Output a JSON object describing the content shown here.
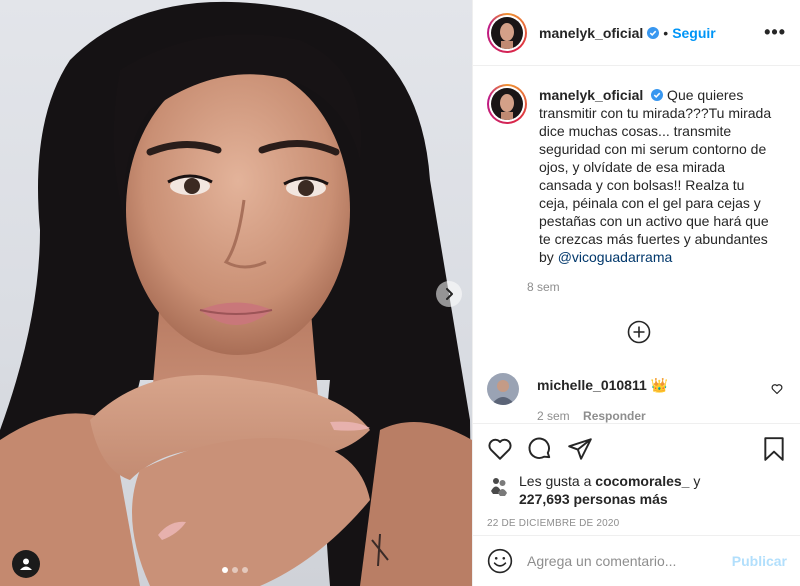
{
  "header": {
    "username": "manelyk_oficial",
    "separator": "•",
    "follow_label": "Seguir",
    "more_label": "•••"
  },
  "caption": {
    "username": "manelyk_oficial",
    "text": " Que quieres transmitir con tu mirada???Tu mirada dice muchas cosas... transmite seguridad con mi serum contorno de ojos, y olvídate de esa mirada cansada y con bolsas!! Realza tu ceja, péinala con el gel para cejas y pestañas con un activo que hará que te crezcas más fuertes y abundantes by ",
    "mention": "@vicoguadarrama",
    "time": "8 sem"
  },
  "comments": [
    {
      "username": "michelle_010811",
      "emoji": "👑",
      "time": "2 sem",
      "reply_label": "Responder"
    }
  ],
  "likes": {
    "prefix": "Les gusta a ",
    "user": "cocomorales_",
    "middle": " y",
    "count": "227,693 personas más"
  },
  "date": "22 DE DICIEMBRE DE 2020",
  "add_comment": {
    "placeholder": "Agrega un comentario...",
    "post_label": "Publicar"
  },
  "carousel": {
    "total": 3,
    "active": 1
  },
  "colors": {
    "accent": "#0095f6",
    "verified": "#3897f0",
    "mention": "#00376b",
    "muted": "#8e8e8e",
    "post_disabled": "#b2dffc"
  },
  "icons": {
    "verified": "verified-badge-icon",
    "next": "chevron-right-icon",
    "tag": "user-tag-icon",
    "add": "plus-circle-icon",
    "like": "heart-icon",
    "comment": "comment-bubble-icon",
    "share": "paper-plane-icon",
    "save": "bookmark-icon",
    "emoji": "smiley-icon"
  }
}
